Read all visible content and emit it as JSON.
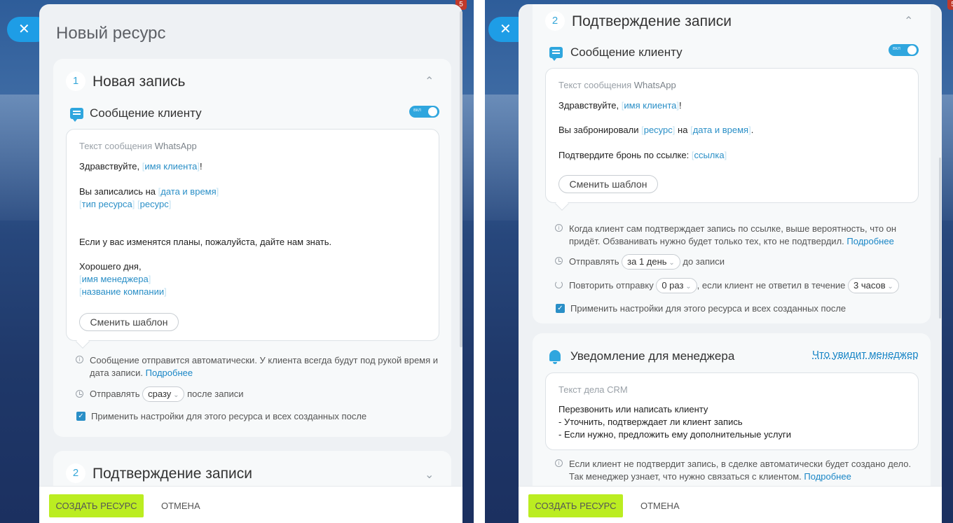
{
  "left": {
    "panel_title": "Новый ресурс",
    "step1": {
      "num": "1",
      "title": "Новая запись"
    },
    "client_msg": {
      "title": "Сообщение клиенту",
      "toggle": "вкл"
    },
    "msgbox": {
      "label_prefix": "Текст сообщения",
      "label_channel": "WhatsApp",
      "l1_a": "Здравствуйте,",
      "l1_tag": "имя клиента",
      "l1_b": "!",
      "l2_a": "Вы записались на",
      "l2_tag": "дата и время",
      "l3_tag1": "тип ресурса",
      "l3_tag2": "ресурс",
      "l4": "Если у вас изменятся планы, пожалуйста, дайте нам знать.",
      "l5": "Хорошего дня,",
      "l6_tag": "имя менеджера",
      "l7_tag": "название компании",
      "change_template": "Сменить шаблон"
    },
    "info_note": "Сообщение отправится автоматически. У клиента всегда будут под рукой время и дата записи.",
    "info_more": "Подробнее",
    "send_prefix": "Отправлять",
    "send_value": "сразу",
    "send_suffix": "после записи",
    "apply_label": "Применить настройки для этого ресурса и всех созданных после",
    "step2": {
      "num": "2",
      "title": "Подтверждение записи"
    },
    "footer": {
      "create": "СОЗДАТЬ РЕСУРС",
      "cancel": "ОТМЕНА"
    }
  },
  "right": {
    "step2": {
      "num": "2",
      "title": "Подтверждение записи"
    },
    "client_msg": {
      "title": "Сообщение клиенту",
      "toggle": "вкл"
    },
    "msgbox": {
      "label_prefix": "Текст сообщения",
      "label_channel": "WhatsApp",
      "l1_a": "Здравствуйте,",
      "l1_tag": "имя клиента",
      "l1_b": "!",
      "l2_a": "Вы забронировали",
      "l2_tag1": "ресурс",
      "l2_b": "на",
      "l2_tag2": "дата и время",
      "l2_c": ".",
      "l3_a": "Подтвердите бронь по ссылке:",
      "l3_tag": "ссылка",
      "change_template": "Сменить шаблон"
    },
    "info_note_1": "Когда клиент сам подтверждает запись по ссылке, выше вероятность, что он",
    "info_note_2": "придёт. Обзванивать нужно будет только тех, кто не подтвердил.",
    "info_more": "Подробнее",
    "send_prefix": "Отправлять",
    "send_value": "за 1 день",
    "send_suffix": "до записи",
    "repeat_prefix": "Повторить отправку",
    "repeat_value": "0 раз",
    "repeat_mid": ", если клиент не ответил в течение",
    "repeat_hours": "3 часов",
    "apply_label": "Применить настройки для этого ресурса и всех созданных после",
    "manager": {
      "title": "Уведомление для менеджера",
      "what_link": "Что увидит менеджер",
      "box_label": "Текст дела CRM",
      "line1": "Перезвонить или написать клиенту",
      "line2": "- Уточнить, подтверждает ли клиент запись",
      "line3": "- Если нужно, предложить ему дополнительные услуги",
      "note_1": "Если клиент не подтвердит запись, в сделке автоматически будет создано дело.",
      "note_2": "Так менеджер узнает, что нужно связаться с клиентом.",
      "note_more": "Подробнее"
    },
    "footer": {
      "create": "СОЗДАТЬ РЕСУРС",
      "cancel": "ОТМЕНА"
    }
  },
  "badge": "5",
  "close_icon": "✕"
}
